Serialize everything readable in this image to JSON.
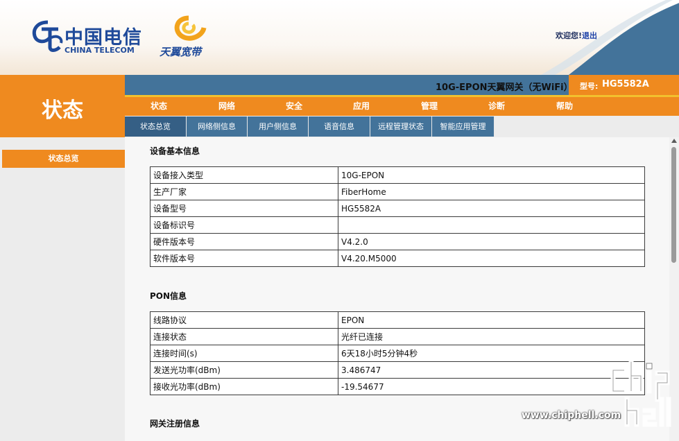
{
  "header": {
    "brand_cn": "中国电信",
    "brand_en": "CHINA TELECOM",
    "tianyi": "天翼宽带",
    "welcome": "欢迎您!",
    "logout": "退出"
  },
  "page_title": "状态",
  "gateway_title": "10G-EPON天翼网关（无WiFi）",
  "model": {
    "label": "型号:",
    "value": "HG5582A"
  },
  "menu": [
    "状态",
    "网络",
    "安全",
    "应用",
    "管理",
    "诊断",
    "帮助"
  ],
  "subtabs": [
    "状态总览",
    "网络侧信息",
    "用户侧信息",
    "语音信息",
    "远程管理状态",
    "智能应用管理"
  ],
  "sidebar": {
    "items": [
      "状态总览"
    ]
  },
  "sections": {
    "device": {
      "title": "设备基本信息",
      "rows": [
        [
          "设备接入类型",
          "10G-EPON"
        ],
        [
          "生产厂家",
          "FiberHome"
        ],
        [
          "设备型号",
          "HG5582A"
        ],
        [
          "设备标识号",
          ""
        ],
        [
          "硬件版本号",
          "V4.2.0"
        ],
        [
          "软件版本号",
          "V4.20.M5000"
        ]
      ]
    },
    "pon": {
      "title": "PON信息",
      "rows": [
        [
          "线路协议",
          "EPON"
        ],
        [
          "连接状态",
          "光纤已连接"
        ],
        [
          "连接时间(s)",
          "6天18小时5分钟4秒"
        ],
        [
          "发送光功率(dBm)",
          "3.486747"
        ],
        [
          "接收光功率(dBm)",
          "-19.54677"
        ]
      ]
    },
    "gateway_reg": {
      "title": "网关注册信息"
    }
  },
  "watermark": {
    "text": "www.chiphell.com"
  },
  "colors": {
    "orange": "#ef8a1f",
    "steel_blue": "#43739a",
    "gold": "#f2c12e",
    "brand_blue": "#1f4a9a"
  }
}
